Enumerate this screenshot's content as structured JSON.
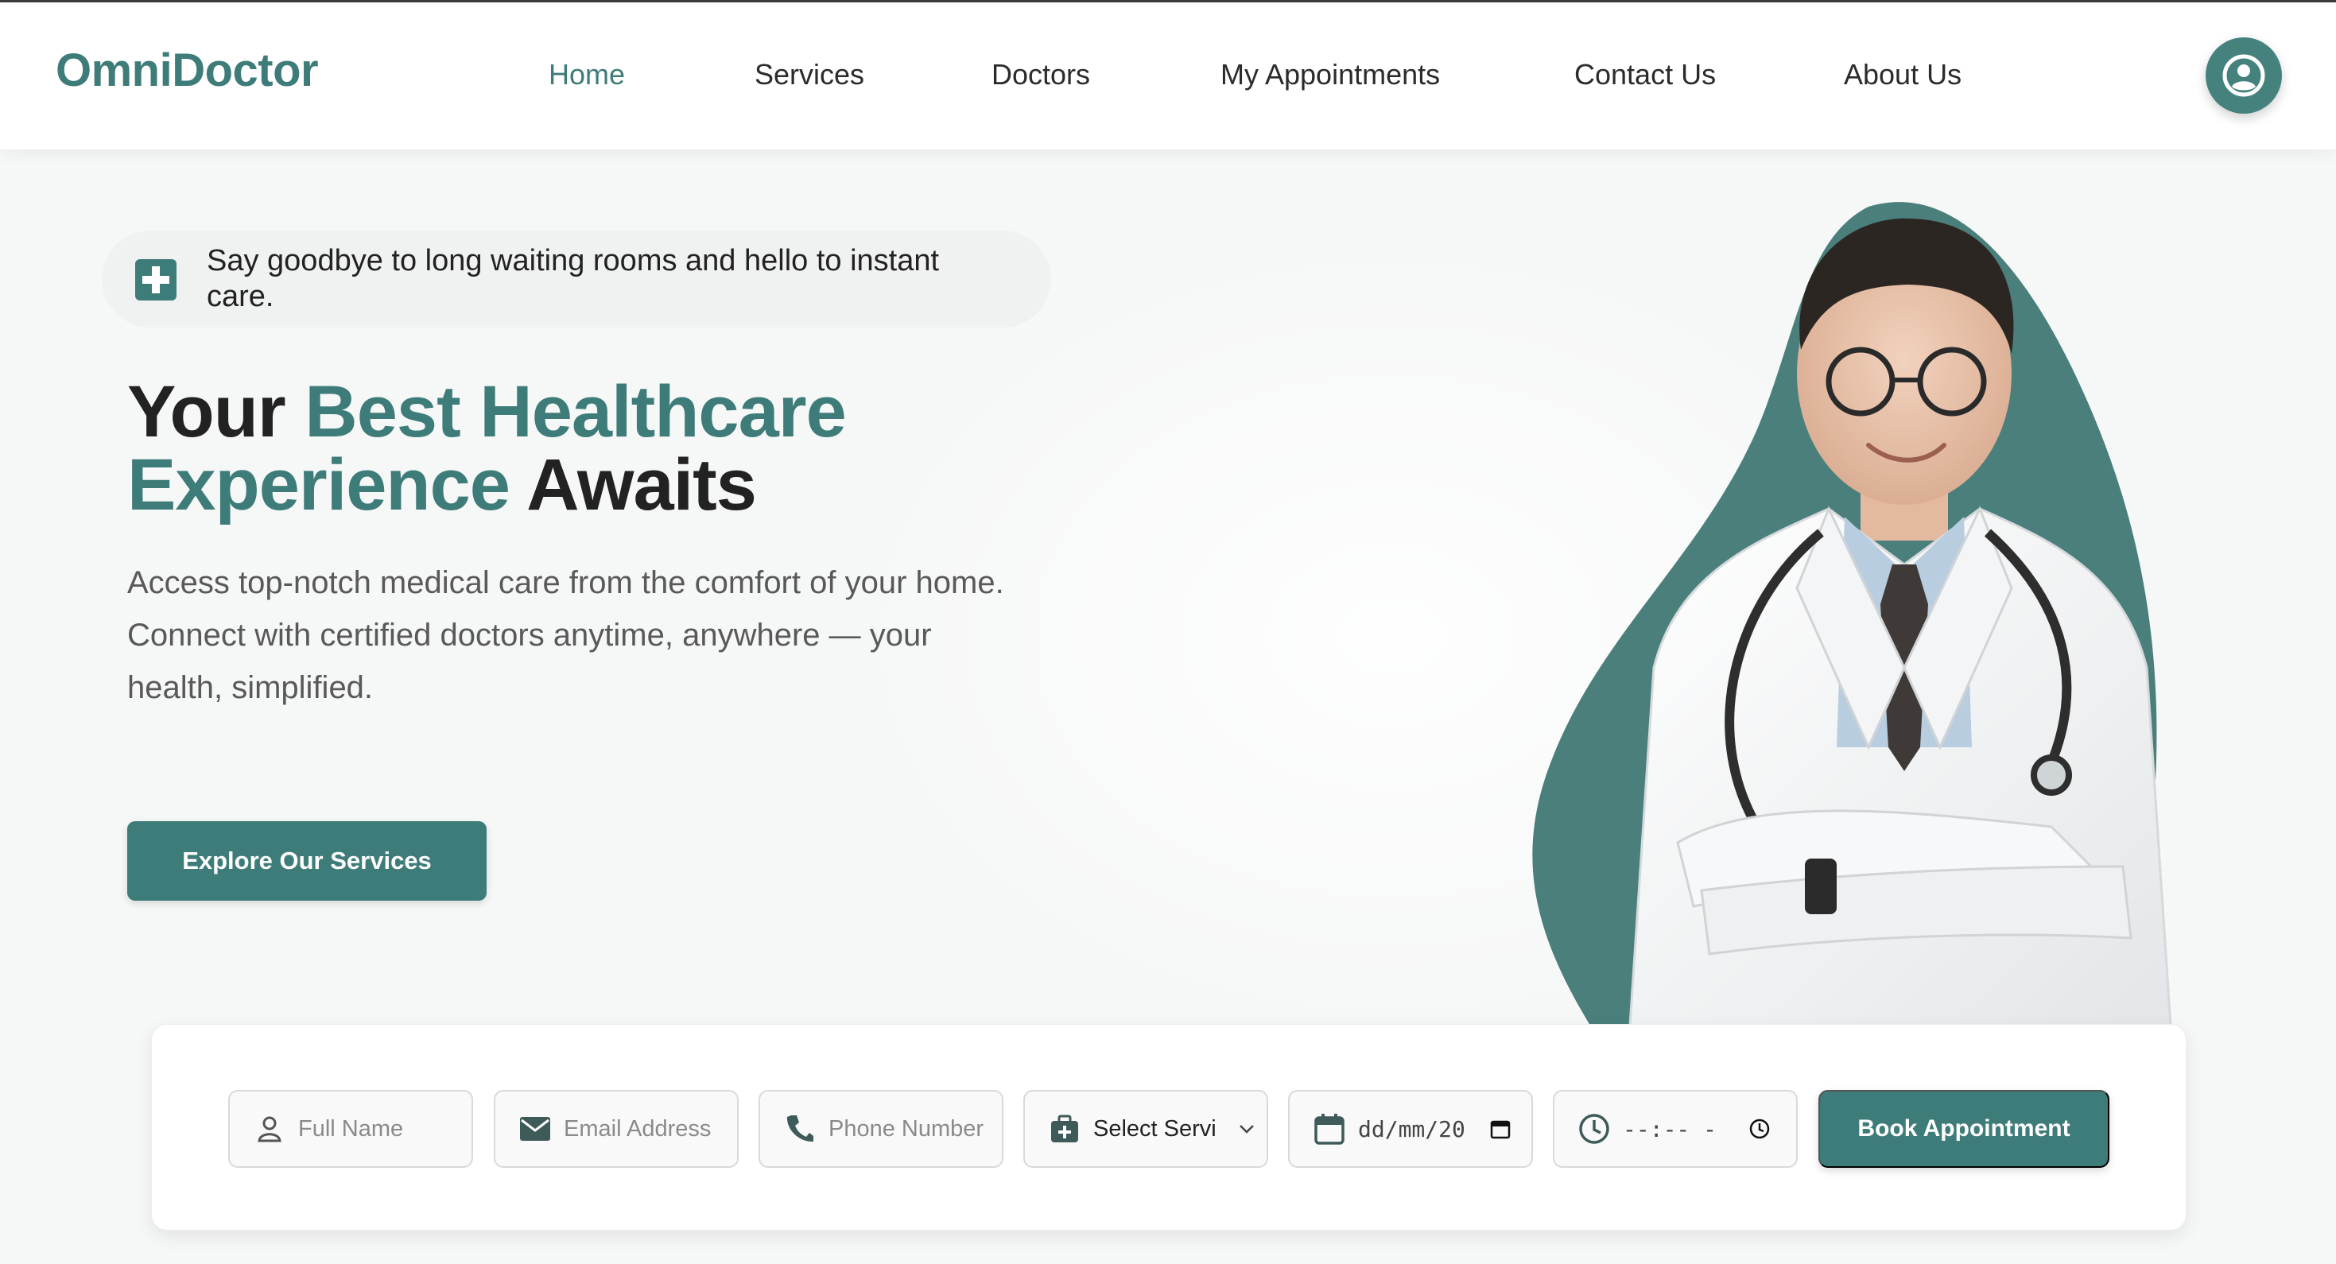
{
  "brand": {
    "name": "OmniDoctor",
    "accent_color": "#3e7c79"
  },
  "nav": {
    "items": [
      {
        "label": "Home",
        "active": true
      },
      {
        "label": "Services",
        "active": false
      },
      {
        "label": "Doctors",
        "active": false
      },
      {
        "label": "My Appointments",
        "active": false
      },
      {
        "label": "Contact Us",
        "active": false
      },
      {
        "label": "About Us",
        "active": false
      }
    ],
    "profile_icon": "user-circle-icon"
  },
  "hero": {
    "tagline_icon": "medical-plus-icon",
    "tagline": "Say goodbye to long waiting rooms and hello to instant care.",
    "headline": {
      "part1": "Your ",
      "part2": "Best Healthcare",
      "part3": "Experience",
      "part4": " Awaits"
    },
    "description_line1": "Access top-notch medical care from the comfort of your home.",
    "description_line2": "Connect with certified doctors anytime, anywhere — your health, simplified.",
    "cta_label": "Explore Our Services",
    "image": "smiling-doctor-in-white-coat-with-stethoscope"
  },
  "booking": {
    "full_name_placeholder": "Full Name",
    "email_placeholder": "Email Address",
    "phone_placeholder": "Phone Number",
    "service_select_value": "Select Servi",
    "date_value": "dd/mm/20",
    "time_value": "--:-- -",
    "submit_label": "Book Appointment",
    "icons": [
      "person-icon",
      "mail-icon",
      "phone-icon",
      "medkit-icon",
      "calendar-icon",
      "clock-icon",
      "chevron-down-icon"
    ]
  }
}
